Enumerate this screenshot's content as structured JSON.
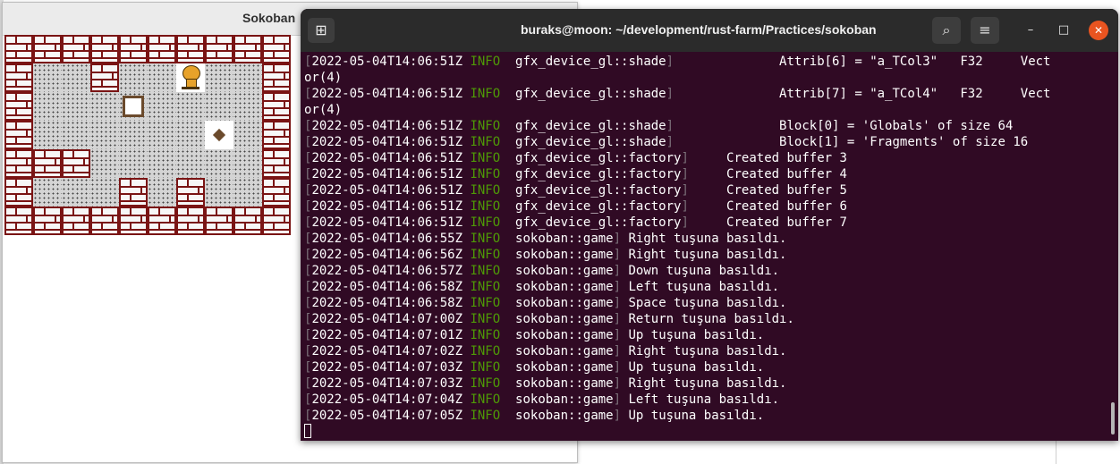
{
  "sokoban": {
    "title": "Sokoban",
    "board": [
      "WWWWWWWWWW",
      "W..W..P..W",
      "W...B....W",
      "W......G.W",
      "WWW......W",
      "W...W.W..W",
      "WWWWWWWWWW"
    ]
  },
  "terminal": {
    "title": "buraks@moon: ~/development/rust-farm/Practices/sokoban",
    "icons": {
      "new_tab": "new-tab-icon",
      "search": "search-icon",
      "menu": "hamburger-menu-icon",
      "minimize": "minimize-icon",
      "maximize": "maximize-icon",
      "close": "close-icon"
    },
    "glyphs": {
      "new_tab": "⊞",
      "search": "⌕",
      "menu": "≡",
      "minimize": "–",
      "maximize": "□",
      "close": "✕"
    },
    "colors": {
      "background": "#300a24",
      "level": "#4e9a06",
      "bracket": "#7a6f78",
      "close_button": "#e95420"
    },
    "lines": [
      {
        "open": "[",
        "ts": "2022-05-04T14:06:51Z",
        "level": "INFO",
        "target": "gfx_device_gl::shade",
        "close": "]",
        "msg": "              Attrib[6] = \"a_TCol3\"   F32     Vect"
      },
      {
        "open": "",
        "ts": "",
        "level": "",
        "target": "",
        "close": "",
        "msg": "or(4)"
      },
      {
        "open": "[",
        "ts": "2022-05-04T14:06:51Z",
        "level": "INFO",
        "target": "gfx_device_gl::shade",
        "close": "]",
        "msg": "              Attrib[7] = \"a_TCol4\"   F32     Vect"
      },
      {
        "open": "",
        "ts": "",
        "level": "",
        "target": "",
        "close": "",
        "msg": "or(4)"
      },
      {
        "open": "[",
        "ts": "2022-05-04T14:06:51Z",
        "level": "INFO",
        "target": "gfx_device_gl::shade",
        "close": "]",
        "msg": "              Block[0] = 'Globals' of size 64"
      },
      {
        "open": "[",
        "ts": "2022-05-04T14:06:51Z",
        "level": "INFO",
        "target": "gfx_device_gl::shade",
        "close": "]",
        "msg": "              Block[1] = 'Fragments' of size 16"
      },
      {
        "open": "[",
        "ts": "2022-05-04T14:06:51Z",
        "level": "INFO",
        "target": "gfx_device_gl::factory",
        "close": "]",
        "msg": "     Created buffer 3"
      },
      {
        "open": "[",
        "ts": "2022-05-04T14:06:51Z",
        "level": "INFO",
        "target": "gfx_device_gl::factory",
        "close": "]",
        "msg": "     Created buffer 4"
      },
      {
        "open": "[",
        "ts": "2022-05-04T14:06:51Z",
        "level": "INFO",
        "target": "gfx_device_gl::factory",
        "close": "]",
        "msg": "     Created buffer 5"
      },
      {
        "open": "[",
        "ts": "2022-05-04T14:06:51Z",
        "level": "INFO",
        "target": "gfx_device_gl::factory",
        "close": "]",
        "msg": "     Created buffer 6"
      },
      {
        "open": "[",
        "ts": "2022-05-04T14:06:51Z",
        "level": "INFO",
        "target": "gfx_device_gl::factory",
        "close": "]",
        "msg": "     Created buffer 7"
      },
      {
        "open": "[",
        "ts": "2022-05-04T14:06:55Z",
        "level": "INFO",
        "target": "sokoban::game",
        "close": "]",
        "msg": " Right tuşuna basıldı."
      },
      {
        "open": "[",
        "ts": "2022-05-04T14:06:56Z",
        "level": "INFO",
        "target": "sokoban::game",
        "close": "]",
        "msg": " Right tuşuna basıldı."
      },
      {
        "open": "[",
        "ts": "2022-05-04T14:06:57Z",
        "level": "INFO",
        "target": "sokoban::game",
        "close": "]",
        "msg": " Down tuşuna basıldı."
      },
      {
        "open": "[",
        "ts": "2022-05-04T14:06:58Z",
        "level": "INFO",
        "target": "sokoban::game",
        "close": "]",
        "msg": " Left tuşuna basıldı."
      },
      {
        "open": "[",
        "ts": "2022-05-04T14:06:58Z",
        "level": "INFO",
        "target": "sokoban::game",
        "close": "]",
        "msg": " Space tuşuna basıldı."
      },
      {
        "open": "[",
        "ts": "2022-05-04T14:07:00Z",
        "level": "INFO",
        "target": "sokoban::game",
        "close": "]",
        "msg": " Return tuşuna basıldı."
      },
      {
        "open": "[",
        "ts": "2022-05-04T14:07:01Z",
        "level": "INFO",
        "target": "sokoban::game",
        "close": "]",
        "msg": " Up tuşuna basıldı."
      },
      {
        "open": "[",
        "ts": "2022-05-04T14:07:02Z",
        "level": "INFO",
        "target": "sokoban::game",
        "close": "]",
        "msg": " Right tuşuna basıldı."
      },
      {
        "open": "[",
        "ts": "2022-05-04T14:07:03Z",
        "level": "INFO",
        "target": "sokoban::game",
        "close": "]",
        "msg": " Up tuşuna basıldı."
      },
      {
        "open": "[",
        "ts": "2022-05-04T14:07:03Z",
        "level": "INFO",
        "target": "sokoban::game",
        "close": "]",
        "msg": " Right tuşuna basıldı."
      },
      {
        "open": "[",
        "ts": "2022-05-04T14:07:04Z",
        "level": "INFO",
        "target": "sokoban::game",
        "close": "]",
        "msg": " Left tuşuna basıldı."
      },
      {
        "open": "[",
        "ts": "2022-05-04T14:07:05Z",
        "level": "INFO",
        "target": "sokoban::game",
        "close": "]",
        "msg": " Up tuşuna basıldı."
      }
    ]
  }
}
